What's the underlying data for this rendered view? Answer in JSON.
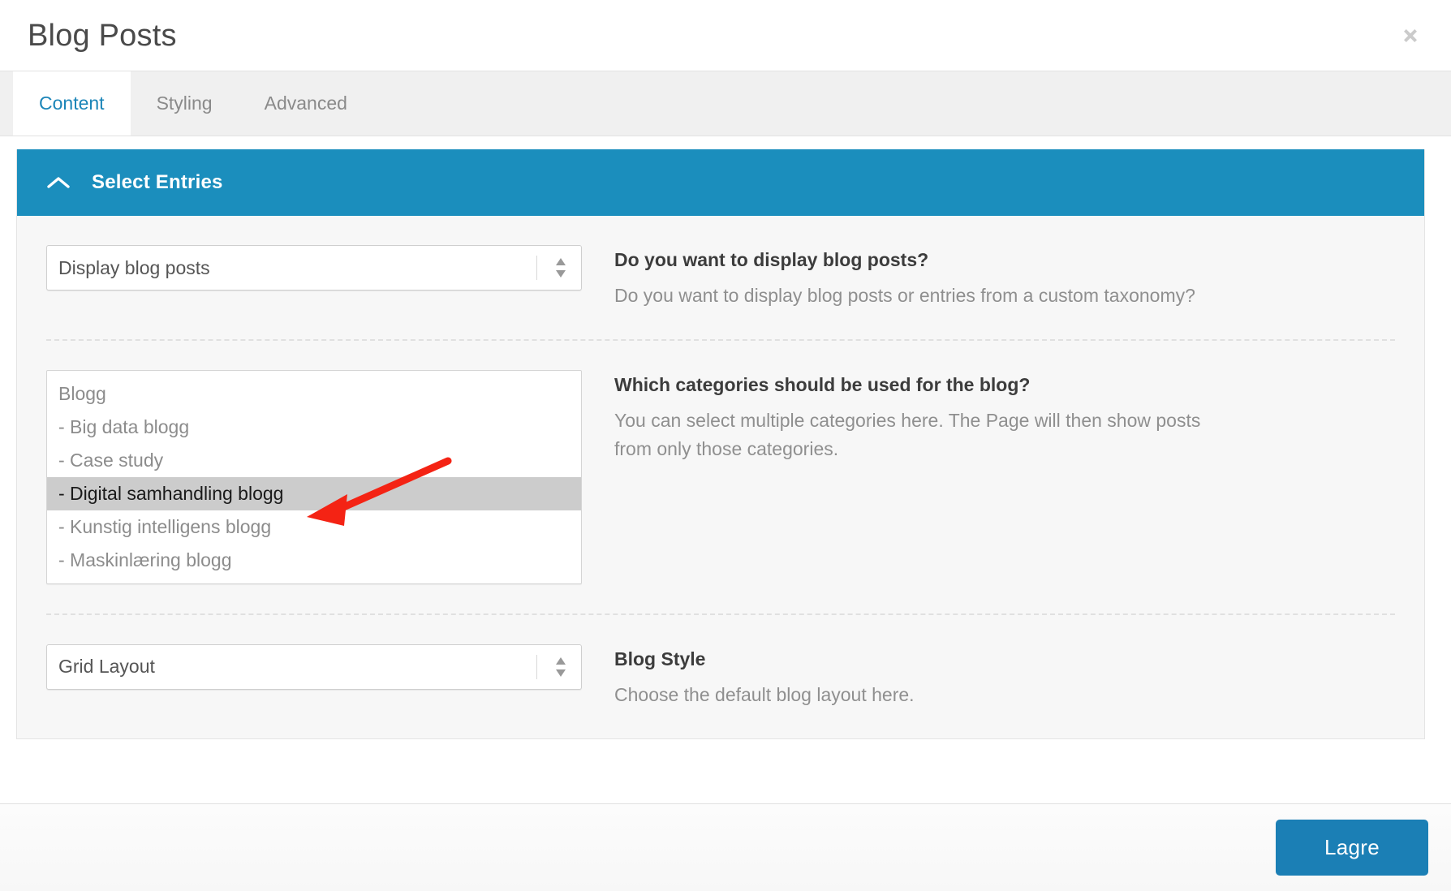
{
  "header": {
    "title": "Blog Posts",
    "close_icon": "close-icon"
  },
  "tabs": [
    {
      "label": "Content",
      "active": true
    },
    {
      "label": "Styling",
      "active": false
    },
    {
      "label": "Advanced",
      "active": false
    }
  ],
  "panel": {
    "title": "Select Entries",
    "collapse_icon": "chevron-up-icon",
    "accent_color": "#1b8ebd"
  },
  "fields": [
    {
      "type": "select",
      "value": "Display blog posts",
      "title": "Do you want to display blog posts?",
      "description": "Do you want to display blog posts or entries from a custom taxonomy?"
    },
    {
      "type": "list",
      "title": "Which categories should be used for the blog?",
      "description": "You can select multiple categories here. The Page will then show posts from only those categories.",
      "options": [
        {
          "label": "Blogg",
          "selected": false
        },
        {
          "label": "- Big data blogg",
          "selected": false
        },
        {
          "label": "- Case study",
          "selected": false
        },
        {
          "label": "- Digital samhandling blogg",
          "selected": true
        },
        {
          "label": "- Kunstig intelligens blogg",
          "selected": false
        },
        {
          "label": "- Maskinlæring blogg",
          "selected": false
        }
      ]
    },
    {
      "type": "select",
      "value": "Grid Layout",
      "title": "Blog Style",
      "description": "Choose the default blog layout here."
    }
  ],
  "footer": {
    "save_label": "Lagre",
    "save_color": "#1b7fb5"
  },
  "annotation": {
    "arrow_color": "#f42314",
    "points_at": "- Digital samhandling blogg"
  }
}
